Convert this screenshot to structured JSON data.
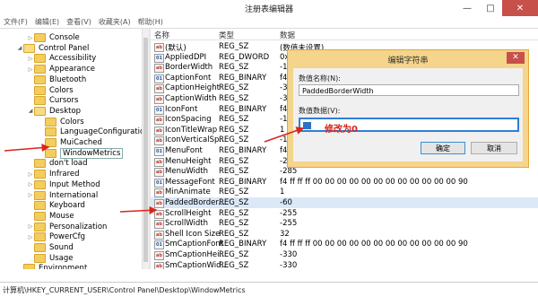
{
  "window": {
    "title": "注册表编辑器",
    "minimize": "—",
    "maximize": "□",
    "close": "✕"
  },
  "menu": [
    "文件(F)",
    "编辑(E)",
    "查看(V)",
    "收藏夹(A)",
    "帮助(H)"
  ],
  "tree": [
    {
      "label": "Console",
      "depth": 3,
      "arrow": "▷"
    },
    {
      "label": "Control Panel",
      "depth": 2,
      "arrow": "◢",
      "open": true
    },
    {
      "label": "Accessibility",
      "depth": 3,
      "arrow": "▷"
    },
    {
      "label": "Appearance",
      "depth": 3,
      "arrow": "▷"
    },
    {
      "label": "Bluetooth",
      "depth": 3,
      "arrow": ""
    },
    {
      "label": "Colors",
      "depth": 3,
      "arrow": ""
    },
    {
      "label": "Cursors",
      "depth": 3,
      "arrow": ""
    },
    {
      "label": "Desktop",
      "depth": 3,
      "arrow": "◢",
      "open": true
    },
    {
      "label": "Colors",
      "depth": 4,
      "arrow": ""
    },
    {
      "label": "LanguageConfiguration",
      "depth": 4,
      "arrow": ""
    },
    {
      "label": "MuiCached",
      "depth": 4,
      "arrow": ""
    },
    {
      "label": "WindowMetrics",
      "depth": 4,
      "arrow": "",
      "selected": true
    },
    {
      "label": "don't load",
      "depth": 3,
      "arrow": ""
    },
    {
      "label": "Infrared",
      "depth": 3,
      "arrow": "▷"
    },
    {
      "label": "Input Method",
      "depth": 3,
      "arrow": "▷"
    },
    {
      "label": "International",
      "depth": 3,
      "arrow": "▷"
    },
    {
      "label": "Keyboard",
      "depth": 3,
      "arrow": ""
    },
    {
      "label": "Mouse",
      "depth": 3,
      "arrow": ""
    },
    {
      "label": "Personalization",
      "depth": 3,
      "arrow": "▷"
    },
    {
      "label": "PowerCfg",
      "depth": 3,
      "arrow": "▷"
    },
    {
      "label": "Sound",
      "depth": 3,
      "arrow": ""
    },
    {
      "label": "Usage",
      "depth": 3,
      "arrow": ""
    },
    {
      "label": "Environment",
      "depth": 2,
      "arrow": ""
    }
  ],
  "columns": {
    "name": "名称",
    "type": "类型",
    "data": "数据"
  },
  "values": [
    {
      "name": "(默认)",
      "type": "REG_SZ",
      "data": "(数值未设置)",
      "icon": "ab"
    },
    {
      "name": "AppliedDPI",
      "type": "REG_DWORD",
      "data": "0x",
      "icon": "01"
    },
    {
      "name": "BorderWidth",
      "type": "REG_SZ",
      "data": "-1",
      "icon": "ab"
    },
    {
      "name": "CaptionFont",
      "type": "REG_BINARY",
      "data": "f4",
      "icon": "01"
    },
    {
      "name": "CaptionHeight",
      "type": "REG_SZ",
      "data": "-3",
      "icon": "ab"
    },
    {
      "name": "CaptionWidth",
      "type": "REG_SZ",
      "data": "-3",
      "icon": "ab"
    },
    {
      "name": "IconFont",
      "type": "REG_BINARY",
      "data": "f4",
      "icon": "01"
    },
    {
      "name": "IconSpacing",
      "type": "REG_SZ",
      "data": "-1",
      "icon": "ab"
    },
    {
      "name": "IconTitleWrap",
      "type": "REG_SZ",
      "data": "1",
      "icon": "ab"
    },
    {
      "name": "IconVerticalSp...",
      "type": "REG_SZ",
      "data": "-1",
      "icon": "ab"
    },
    {
      "name": "MenuFont",
      "type": "REG_BINARY",
      "data": "f4",
      "icon": "01"
    },
    {
      "name": "MenuHeight",
      "type": "REG_SZ",
      "data": "-285",
      "icon": "ab"
    },
    {
      "name": "MenuWidth",
      "type": "REG_SZ",
      "data": "-285",
      "icon": "ab"
    },
    {
      "name": "MessageFont",
      "type": "REG_BINARY",
      "data": "f4 ff ff ff 00 00 00 00 00 00 00 00 00 00 00 00 90",
      "icon": "01"
    },
    {
      "name": "MinAnimate",
      "type": "REG_SZ",
      "data": "1",
      "icon": "ab"
    },
    {
      "name": "PaddedBorder...",
      "type": "REG_SZ",
      "data": "-60",
      "icon": "ab",
      "selected": true
    },
    {
      "name": "ScrollHeight",
      "type": "REG_SZ",
      "data": "-255",
      "icon": "ab"
    },
    {
      "name": "ScrollWidth",
      "type": "REG_SZ",
      "data": "-255",
      "icon": "ab"
    },
    {
      "name": "Shell Icon Size",
      "type": "REG_SZ",
      "data": "32",
      "icon": "ab"
    },
    {
      "name": "SmCaptionFont",
      "type": "REG_BINARY",
      "data": "f4 ff ff ff 00 00 00 00 00 00 00 00 00 00 00 00 90",
      "icon": "01"
    },
    {
      "name": "SmCaptionHei...",
      "type": "REG_SZ",
      "data": "-330",
      "icon": "ab"
    },
    {
      "name": "SmCaptionWid...",
      "type": "REG_SZ",
      "data": "-330",
      "icon": "ab"
    }
  ],
  "statusbar": "计算机\\HKEY_CURRENT_USER\\Control Panel\\Desktop\\WindowMetrics",
  "dialog": {
    "title": "编辑字符串",
    "close": "✕",
    "name_label": "数值名称(N):",
    "name_value": "PaddedBorderWidth",
    "data_label": "数值数据(V):",
    "annotation": "修改为0",
    "ok": "确定",
    "cancel": "取消"
  },
  "colors": {
    "annotation": "#d9261c",
    "dialog_frame": "#f5d48b",
    "selection": "#dbe8f7"
  }
}
